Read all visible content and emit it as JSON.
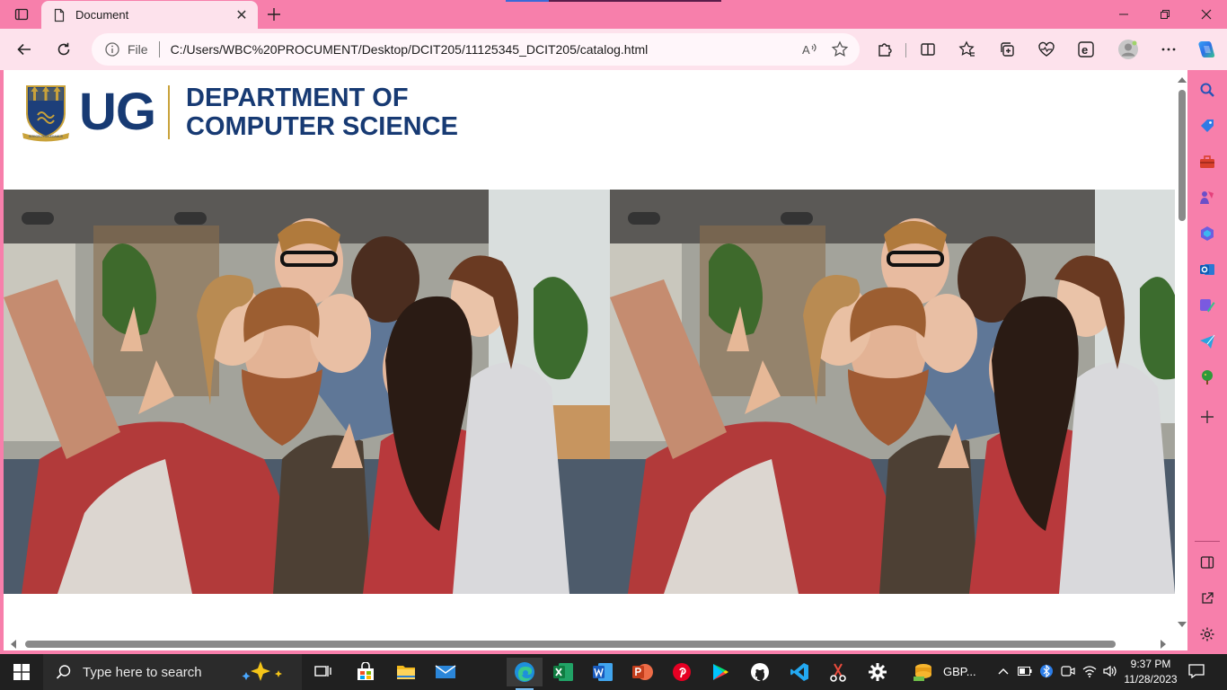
{
  "browser": {
    "tab_title": "Document",
    "address_prefix": "File",
    "url": "C:/Users/WBC%20PROCUMENT/Desktop/DCIT205/11125345_DCIT205/catalog.html"
  },
  "page": {
    "logo_text": "UG",
    "department_line1": "DEPARTMENT OF",
    "department_line2": "COMPUTER SCIENCE",
    "crest_motto": "INTEGRI PROCEDAMUS"
  },
  "taskbar": {
    "search_placeholder": "Type here to search",
    "weather_label": "GBP...",
    "time": "9:37 PM",
    "date": "11/28/2023"
  },
  "icons": {
    "tab_actions": "tab-actions-icon",
    "doc": "document-icon",
    "back": "back-arrow-icon",
    "refresh": "refresh-icon",
    "read_aloud": "read-aloud-icon",
    "favorite": "star-icon"
  },
  "colors": {
    "frame_pink": "#f77fab",
    "toolbar_pink": "#fde2ec",
    "ug_blue": "#173a73",
    "ug_gold": "#c9a23a",
    "taskbar": "#202020"
  }
}
